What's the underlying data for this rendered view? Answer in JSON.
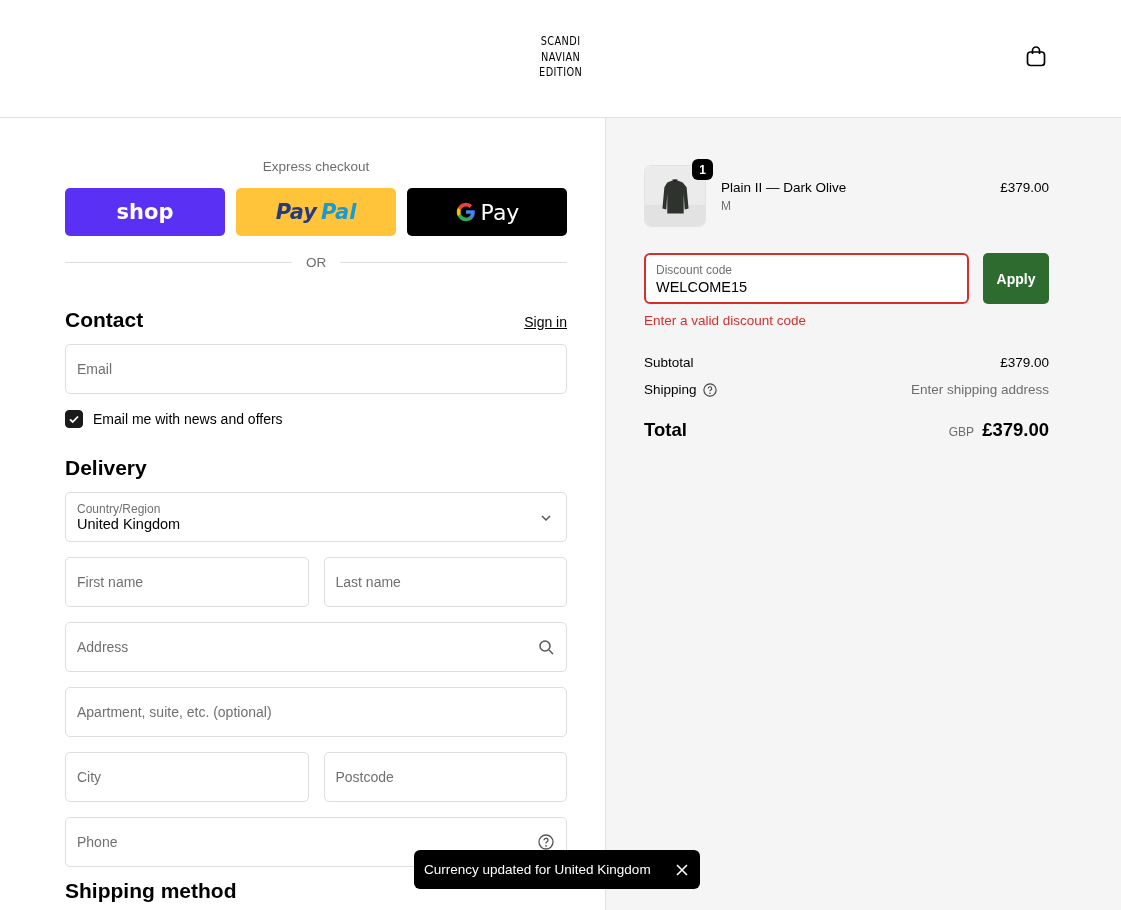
{
  "header": {
    "logo_lines": [
      "SCANDI",
      "NAVIAN",
      "EDITION"
    ]
  },
  "express_checkout": {
    "title": "Express checkout",
    "buttons": [
      {
        "kind": "shop",
        "label": "shop"
      },
      {
        "kind": "paypal",
        "label": "Pay",
        "label_2": "Pal"
      },
      {
        "kind": "gpay",
        "label": "Pay"
      }
    ],
    "divider": "OR"
  },
  "contact": {
    "heading": "Contact",
    "sign_in": "Sign in",
    "email": {
      "placeholder": "Email"
    },
    "newsletter": {
      "label": "Email me with news and offers",
      "checked": true
    }
  },
  "delivery": {
    "heading": "Delivery",
    "rows": [
      [
        {
          "kind": "select",
          "label": "Country/Region",
          "value": "United Kingdom"
        }
      ],
      [
        {
          "kind": "text",
          "placeholder": "First name"
        },
        {
          "kind": "text",
          "placeholder": "Last name"
        }
      ],
      [
        {
          "kind": "search",
          "placeholder": "Address"
        }
      ],
      [
        {
          "kind": "text",
          "placeholder": "Apartment, suite, etc. (optional)"
        }
      ],
      [
        {
          "kind": "text",
          "placeholder": "City"
        },
        {
          "kind": "text",
          "placeholder": "Postcode"
        }
      ],
      [
        {
          "kind": "help",
          "placeholder": "Phone"
        }
      ]
    ]
  },
  "shipping_method": {
    "heading": "Shipping method"
  },
  "summary": {
    "items": [
      {
        "name": "Plain II — Dark Olive",
        "variant": "M",
        "price": "£379.00",
        "quantity": "1"
      }
    ],
    "discount": {
      "label": "Discount code",
      "value": "WELCOME15",
      "error": "Enter a valid discount code",
      "button": "Apply"
    },
    "lines": [
      {
        "kind": "plain",
        "label": "Subtotal",
        "value": "£379.00"
      },
      {
        "kind": "help",
        "label": "Shipping",
        "value": "Enter shipping address"
      }
    ],
    "total": {
      "label": "Total",
      "currency": "GBP",
      "value": "£379.00"
    }
  },
  "toast": {
    "message": "Currency updated for United Kingdom"
  }
}
